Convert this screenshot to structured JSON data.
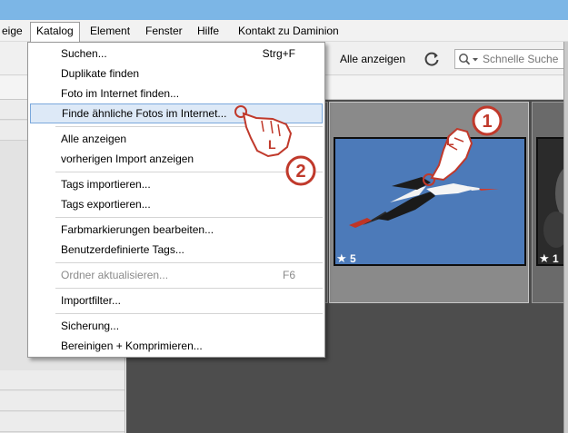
{
  "menubar": {
    "items": [
      "eige",
      "Katalog",
      "Element",
      "Fenster",
      "Hilfe",
      "Kontakt zu Daminion"
    ]
  },
  "toolbar": {
    "show_all": "Alle anzeigen",
    "refresh_icon": "refresh-icon",
    "search_placeholder": "Schnelle Suche"
  },
  "katalog_menu": {
    "items": [
      {
        "label": "Suchen...",
        "shortcut": "Strg+F"
      },
      {
        "label": "Duplikate finden",
        "shortcut": ""
      },
      {
        "label": "Foto im Internet finden...",
        "shortcut": ""
      },
      {
        "label": "Finde ähnliche Fotos im Internet...",
        "shortcut": "",
        "highlighted": true
      },
      {
        "label": "Alle anzeigen",
        "shortcut": ""
      },
      {
        "label": "vorherigen Import anzeigen",
        "shortcut": ""
      },
      {
        "label": "Tags importieren...",
        "shortcut": ""
      },
      {
        "label": "Tags exportieren...",
        "shortcut": ""
      },
      {
        "label": "Farbmarkierungen bearbeiten...",
        "shortcut": ""
      },
      {
        "label": "Benutzerdefinierte Tags...",
        "shortcut": ""
      },
      {
        "label": "Ordner aktualisieren...",
        "shortcut": "F6",
        "disabled": true
      },
      {
        "label": "Importfilter...",
        "shortcut": ""
      },
      {
        "label": "Sicherung...",
        "shortcut": ""
      },
      {
        "label": "Bereinigen + Komprimieren...",
        "shortcut": ""
      }
    ]
  },
  "thumbnails": [
    {
      "rating": "5",
      "subject": "flying stork on blue sky",
      "selected": true
    },
    {
      "rating": "1",
      "subject": "dark foliage",
      "selected": false
    }
  ],
  "annotations": {
    "step_1": "1",
    "step_2": "2",
    "gesture_letter": "L",
    "colors": {
      "badge_red": "#c0392b"
    }
  },
  "colors": {
    "titlebar": "#7cb6e6",
    "highlight_bg": "#dde9f7",
    "highlight_border": "#7aa8dc",
    "gallery_bg": "#4d4d4d",
    "sky_blue": "#4c7ab9"
  }
}
